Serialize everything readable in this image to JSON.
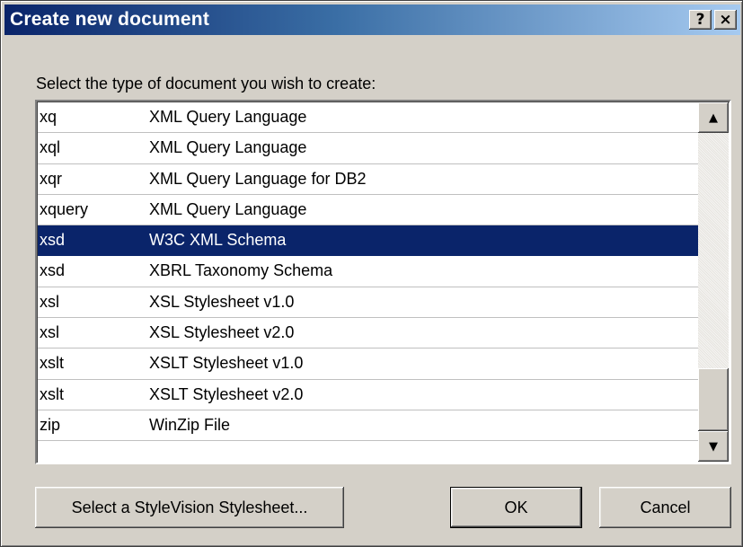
{
  "dialog": {
    "title": "Create new document",
    "help_label": "?",
    "close_label": "×",
    "prompt": "Select the type of document you wish to create:"
  },
  "documents": [
    {
      "ext": "xq",
      "description": "XML Query Language",
      "selected": false
    },
    {
      "ext": "xql",
      "description": "XML Query Language",
      "selected": false
    },
    {
      "ext": "xqr",
      "description": "XML Query Language for DB2",
      "selected": false
    },
    {
      "ext": "xquery",
      "description": "XML Query Language",
      "selected": false
    },
    {
      "ext": "xsd",
      "description": "W3C XML Schema",
      "selected": true
    },
    {
      "ext": "xsd",
      "description": "XBRL Taxonomy Schema",
      "selected": false
    },
    {
      "ext": "xsl",
      "description": "XSL Stylesheet v1.0",
      "selected": false
    },
    {
      "ext": "xsl",
      "description": "XSL Stylesheet v2.0",
      "selected": false
    },
    {
      "ext": "xslt",
      "description": "XSLT Stylesheet v1.0",
      "selected": false
    },
    {
      "ext": "xslt",
      "description": "XSLT Stylesheet v2.0",
      "selected": false
    },
    {
      "ext": "zip",
      "description": "WinZip File",
      "selected": false
    }
  ],
  "scrollbar": {
    "up_icon": "scroll-up-arrow-icon",
    "down_icon": "scroll-down-arrow-icon",
    "up_glyph": "▲",
    "down_glyph": "▼"
  },
  "buttons": {
    "stylevision": "Select a StyleVision Stylesheet...",
    "ok": "OK",
    "cancel": "Cancel"
  },
  "colors": {
    "title_bar_start": "#0a246a",
    "title_bar_end": "#a6caf0",
    "selection": "#0a246a",
    "face": "#d4d0c8"
  }
}
